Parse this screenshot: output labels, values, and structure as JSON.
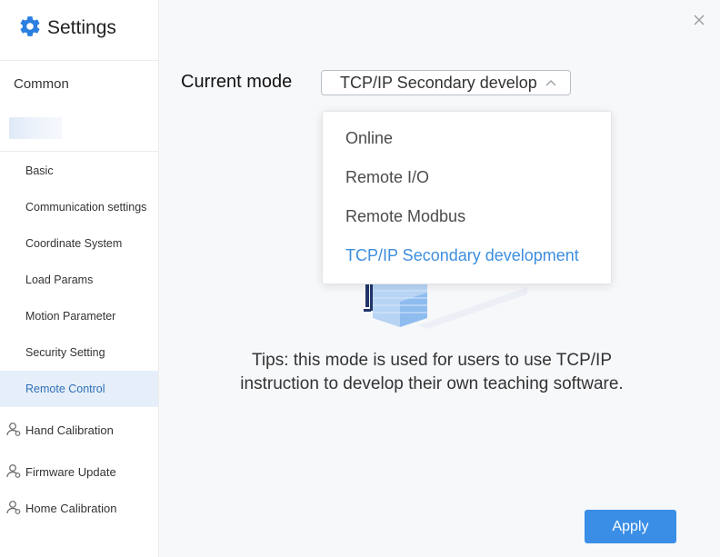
{
  "app": {
    "title": "Settings"
  },
  "sidebar": {
    "common_label": "Common",
    "items": [
      {
        "label": "Basic"
      },
      {
        "label": "Communication settings"
      },
      {
        "label": "Coordinate System"
      },
      {
        "label": "Load Params"
      },
      {
        "label": "Motion Parameter"
      },
      {
        "label": "Security Setting"
      },
      {
        "label": "Remote Control",
        "active": true
      }
    ],
    "groups": [
      {
        "label": "Hand Calibration",
        "icon": "user-icon"
      },
      {
        "label": "Firmware Update",
        "icon": "user-icon"
      },
      {
        "label": "Home Calibration",
        "icon": "user-icon"
      }
    ]
  },
  "main": {
    "mode_label": "Current mode",
    "select": {
      "value": "TCP/IP Secondary development",
      "expanded": true
    },
    "options": [
      {
        "label": "Online"
      },
      {
        "label": "Remote I/O"
      },
      {
        "label": "Remote Modbus"
      },
      {
        "label": "TCP/IP Secondary development",
        "selected": true
      }
    ],
    "tips_line1": "Tips: this mode is used for users to use TCP/IP",
    "tips_line2": "instruction to develop their own teaching software.",
    "apply_label": "Apply"
  },
  "colors": {
    "accent": "#3a8ee6",
    "selected_option": "#3d8ede",
    "active_item_bg": "#e6eff9"
  },
  "icons": {
    "brand": "gear-icon",
    "close": "close-icon",
    "select_arrow": "chevron-up-icon"
  }
}
